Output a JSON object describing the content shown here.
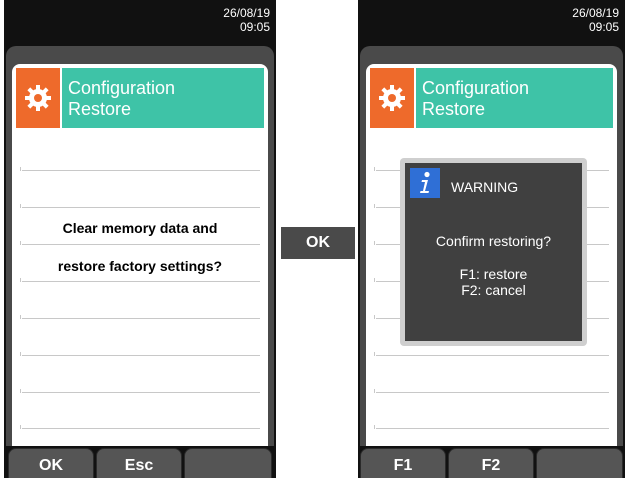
{
  "left_screen": {
    "date": "26/08/19",
    "time": "09:05",
    "title_line1": "Configuration",
    "title_line2": "Restore",
    "message_line1": "Clear memory data and",
    "message_line2": "restore factory settings?",
    "softkeys": [
      "OK",
      "Esc",
      ""
    ]
  },
  "transition": {
    "key_label": "OK"
  },
  "right_screen": {
    "date": "26/08/19",
    "time": "09:05",
    "title_line1": "Configuration",
    "title_line2": "Restore",
    "dialog": {
      "title": "WARNING",
      "question": "Confirm restoring?",
      "option1": "F1: restore",
      "option2": "F2: cancel"
    },
    "softkeys": [
      "F1",
      "F2",
      ""
    ]
  },
  "colors": {
    "accent_orange": "#ee6a2b",
    "accent_teal": "#3ec3a7",
    "info_blue": "#2f6fd6"
  },
  "icons": [
    "gear-icon",
    "info-icon"
  ]
}
